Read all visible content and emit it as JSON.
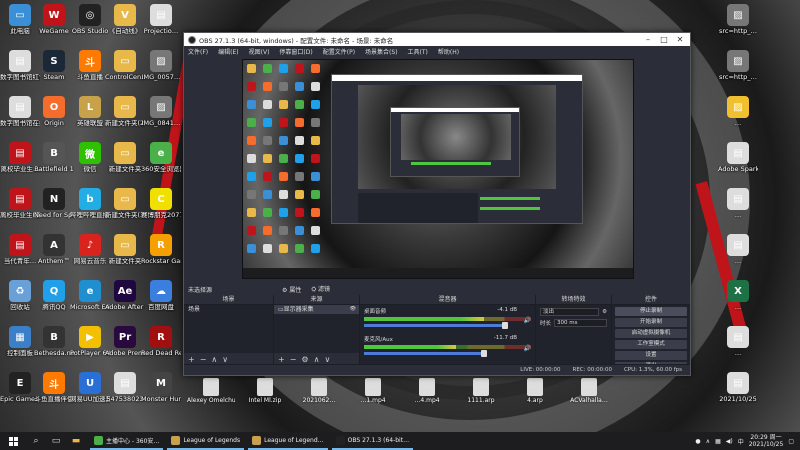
{
  "colors": {
    "accent_red": "#c0141b",
    "obs_bg": "#2b2e38",
    "meter_green": "#4fc63b",
    "slider_blue": "#4e7ad8"
  },
  "desktop": {
    "col1": [
      {
        "label": "此电脑",
        "icon": "pc-icon",
        "color": "#3b8fd6",
        "glyph": "▭"
      },
      {
        "label": "数字图书馆红色…",
        "icon": "doc-icon",
        "color": "#ddd",
        "glyph": "▤"
      },
      {
        "label": "数字图书馆在线服务",
        "icon": "doc-icon",
        "color": "#ddd",
        "glyph": "▤"
      },
      {
        "label": "离校毕业生…",
        "icon": "doc-icon",
        "color": "#c0141b",
        "glyph": "▤"
      },
      {
        "label": "离校毕业生(离校人…",
        "icon": "doc-icon",
        "color": "#c0141b",
        "glyph": "▤"
      },
      {
        "label": "当代青年…",
        "icon": "doc-icon",
        "color": "#c0141b",
        "glyph": "▤"
      },
      {
        "label": "回收站",
        "icon": "recycle-bin-icon",
        "color": "#6aa0d8",
        "glyph": "♻"
      },
      {
        "label": "控制面板",
        "icon": "control-panel-icon",
        "color": "#3a7fc8",
        "glyph": "▦"
      },
      {
        "label": "Epic Games Launcher",
        "icon": "epic-icon",
        "color": "#222",
        "glyph": "E"
      }
    ],
    "col2": [
      {
        "label": "WeGame",
        "icon": "wegame-icon",
        "color": "#c0141b",
        "glyph": "W"
      },
      {
        "label": "Steam",
        "icon": "steam-icon",
        "color": "#1b2838",
        "glyph": "S"
      },
      {
        "label": "Origin",
        "icon": "origin-icon",
        "color": "#f56c2d",
        "glyph": "O"
      },
      {
        "label": "Battlefield 1",
        "icon": "game-icon",
        "color": "#555",
        "glyph": "B"
      },
      {
        "label": "Need for Speed™",
        "icon": "game-icon",
        "color": "#222",
        "glyph": "N"
      },
      {
        "label": "Anthem™",
        "icon": "game-icon",
        "color": "#333",
        "glyph": "A"
      },
      {
        "label": "腾讯QQ",
        "icon": "qq-icon",
        "color": "#1fa0e8",
        "glyph": "Q"
      },
      {
        "label": "Bethesda.net Launcher",
        "icon": "bethesda-icon",
        "color": "#333",
        "glyph": "B"
      },
      {
        "label": "斗鱼直播伴侣",
        "icon": "douyu-icon",
        "color": "#ff7a00",
        "glyph": "斗"
      }
    ],
    "col3": [
      {
        "label": "OBS Studio",
        "icon": "obs-icon",
        "color": "#222",
        "glyph": "◎"
      },
      {
        "label": "斗鱼直播",
        "icon": "douyu-icon",
        "color": "#ff7a00",
        "glyph": "斗"
      },
      {
        "label": "英雄联盟",
        "icon": "lol-icon",
        "color": "#c8a24a",
        "glyph": "L"
      },
      {
        "label": "微信",
        "icon": "wechat-icon",
        "color": "#2dc100",
        "glyph": "微"
      },
      {
        "label": "哔哩哔哩直播姬",
        "icon": "bilibili-icon",
        "color": "#23ade5",
        "glyph": "b"
      },
      {
        "label": "网易云音乐",
        "icon": "netease-icon",
        "color": "#d8241c",
        "glyph": "♪"
      },
      {
        "label": "Microsoft Edge",
        "icon": "edge-icon",
        "color": "#1f8fd0",
        "glyph": "e"
      },
      {
        "label": "PotPlayer 64 bit",
        "icon": "potplayer-icon",
        "color": "#f2c000",
        "glyph": "▶"
      },
      {
        "label": "网易UU加速器",
        "icon": "uu-icon",
        "color": "#2a6fd6",
        "glyph": "U"
      }
    ],
    "col4": [
      {
        "label": "《自动线》",
        "icon": "folder-icon",
        "color": "#e8b84a",
        "glyph": "V"
      },
      {
        "label": "ControlCen…",
        "icon": "folder-icon",
        "color": "#e8b84a",
        "glyph": "▭"
      },
      {
        "label": "新建文件夹(2)",
        "icon": "folder-icon",
        "color": "#e8b84a",
        "glyph": "▭"
      },
      {
        "label": "新建文件夹",
        "icon": "folder-icon",
        "color": "#e8b84a",
        "glyph": "▭"
      },
      {
        "label": "新建文件夹(3)",
        "icon": "folder-icon",
        "color": "#e8b84a",
        "glyph": "▭"
      },
      {
        "label": "新建文件夹",
        "icon": "folder-icon",
        "color": "#e8b84a",
        "glyph": "▭"
      },
      {
        "label": "Adobe After Effects 20…",
        "icon": "ae-icon",
        "color": "#1f0740",
        "glyph": "Ae"
      },
      {
        "label": "Adobe Premiere P…",
        "icon": "pr-icon",
        "color": "#2a0a3e",
        "glyph": "Pr"
      },
      {
        "label": "547538023",
        "icon": "file-icon",
        "color": "#ddd",
        "glyph": "▤"
      }
    ],
    "col5": [
      {
        "label": "Projectio…",
        "icon": "file-icon",
        "color": "#ddd",
        "glyph": "▤"
      },
      {
        "label": "IMG_0057…",
        "icon": "image-icon",
        "color": "#777",
        "glyph": "▨"
      },
      {
        "label": "IMG_0841…",
        "icon": "image-icon",
        "color": "#777",
        "glyph": "▨"
      },
      {
        "label": "360安全浏览器",
        "icon": "browser-360-icon",
        "color": "#4bb04a",
        "glyph": "e"
      },
      {
        "label": "赛博朋克2077",
        "icon": "game-icon",
        "color": "#f0e000",
        "glyph": "C"
      },
      {
        "label": "Rockstar Games…",
        "icon": "rockstar-icon",
        "color": "#f5a000",
        "glyph": "R"
      },
      {
        "label": "百度网盘",
        "icon": "baidu-icon",
        "color": "#3a7fe0",
        "glyph": "☁"
      },
      {
        "label": "Red Dead Redempti…",
        "icon": "game-icon",
        "color": "#a01010",
        "glyph": "R"
      },
      {
        "label": "Monster Hunter…",
        "icon": "game-icon",
        "color": "#444",
        "glyph": "M"
      }
    ],
    "right_col": [
      {
        "label": "src=http_…",
        "icon": "image-icon",
        "color": "#777",
        "glyph": "▨"
      },
      {
        "label": "src=http_…",
        "icon": "image-icon",
        "color": "#777",
        "glyph": "▨"
      },
      {
        "label": "…",
        "icon": "image-icon",
        "color": "#f0c030",
        "glyph": "▨"
      },
      {
        "label": "Adobe Sparky",
        "icon": "doc-icon",
        "color": "#ddd",
        "glyph": "▤"
      },
      {
        "label": "…",
        "icon": "doc-icon",
        "color": "#ddd",
        "glyph": "▤"
      },
      {
        "label": "…",
        "icon": "doc-icon",
        "color": "#ddd",
        "glyph": "▤"
      },
      {
        "label": "…",
        "icon": "excel-icon",
        "color": "#1e7145",
        "glyph": "X"
      },
      {
        "label": "…",
        "icon": "doc-icon",
        "color": "#ddd",
        "glyph": "▤"
      },
      {
        "label": "2021/10/25",
        "icon": "doc-icon",
        "color": "#ddd",
        "glyph": "▤"
      }
    ],
    "bottom_row": [
      {
        "label": "Alexey Omelchuk…",
        "icon": "file-icon"
      },
      {
        "label": "Intel Ml.zip",
        "icon": "zip-icon"
      },
      {
        "label": "2021062…",
        "icon": "file-icon"
      },
      {
        "label": "…1.mp4",
        "icon": "video-icon"
      },
      {
        "label": "…4.mp4",
        "icon": "video-icon"
      },
      {
        "label": "1111.arp",
        "icon": "file-icon"
      },
      {
        "label": "4.arp",
        "icon": "file-icon"
      },
      {
        "label": "ACValhalla…",
        "icon": "file-icon"
      }
    ]
  },
  "obs": {
    "title": "OBS 27.1.3 (64-bit, windows) - 配置文件: 未命名 - 场景: 未命名",
    "menu": [
      "文件(F)",
      "编辑(E)",
      "视图(V)",
      "停靠窗口(D)",
      "配置文件(P)",
      "场景集合(S)",
      "工具(T)",
      "帮助(H)"
    ],
    "no_source_label": "未选择源",
    "props_btn": "属性",
    "filters_btn": "滤镜",
    "docks": {
      "scenes_title": "场景",
      "scene_items": [
        "场景"
      ],
      "sources_title": "来源",
      "source_items": [
        "显示器采集"
      ],
      "mixer_title": "混音器",
      "mixer_channels": [
        {
          "name": "桌面音频",
          "db": "-4.1 dB",
          "level": 0.72,
          "volume": 0.92
        },
        {
          "name": "麦克风/Aux",
          "db": "-11.7 dB",
          "level": 0.55,
          "volume": 0.78
        }
      ],
      "transitions_title": "转场特效",
      "transition_type": "淡出",
      "duration_label": "时长",
      "duration_value": "300 ms",
      "controls_title": "控件",
      "controls": [
        "停止录制",
        "开始录制",
        "启动虚拟摄像机",
        "工作室模式",
        "设置",
        "退出"
      ]
    },
    "status": {
      "live": "LIVE: 00:00:00",
      "rec": "REC: 00:00:00",
      "cpu": "CPU: 1.3%, 60.00 fps"
    }
  },
  "taskbar": {
    "tasks": [
      {
        "label": "主播中心 - 360安…",
        "color": "#4bb04a"
      },
      {
        "label": "League of Legends",
        "color": "#c8a24a"
      },
      {
        "label": "League of Legend…",
        "color": "#c8a24a"
      },
      {
        "label": "OBS 27.1.3 (64-bit…",
        "color": "#222"
      }
    ],
    "lang": "中",
    "time": "20:29 周一",
    "date": "2021/10/25"
  }
}
